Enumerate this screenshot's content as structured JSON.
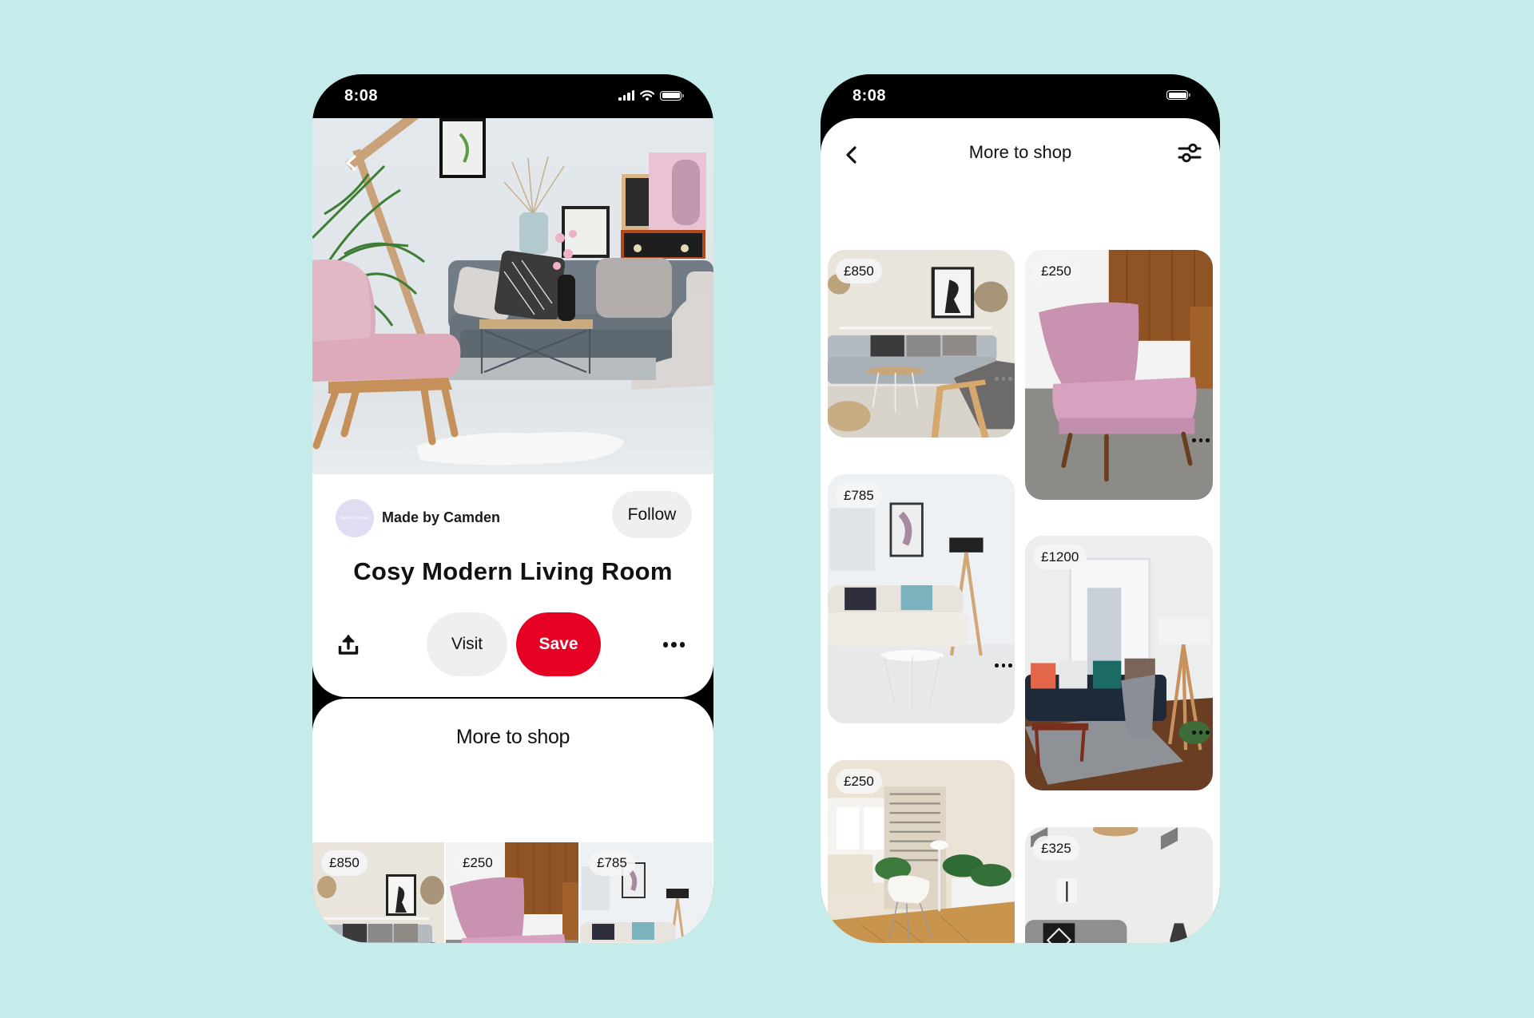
{
  "background_color": "#c5ecea",
  "left_phone": {
    "status_bar": {
      "time": "8:08",
      "icons": [
        "cellular-signal-icon",
        "wifi-icon",
        "battery-icon"
      ]
    },
    "hero_image": {
      "alt": "Pastel living room with pink armchair, grey sofa, palm plant and fluffy rug",
      "overlay_icon": "back-chevron-icon"
    },
    "creator": {
      "avatar_text": "Made by Camden",
      "name": "Made by Camden",
      "follow_label": "Follow"
    },
    "pin_title": "Cosy Modern Living Room",
    "actions": {
      "share_icon": "share-icon",
      "visit_label": "Visit",
      "save_label": "Save",
      "more_icon": "more-horizontal-icon"
    },
    "accent_color": "#e60023",
    "more_to_shop": {
      "title": "More to shop",
      "items": [
        {
          "price": "£850",
          "alt": "Scandi living room with grey sectional and wooden armchair"
        },
        {
          "price": "£250",
          "alt": "Pink cocktail armchair with wooden legs"
        },
        {
          "price": "£785",
          "alt": "Bright living room with cream sofa and tripod lamp"
        }
      ]
    }
  },
  "right_phone": {
    "status_bar": {
      "time": "8:08",
      "icons": [
        "battery-icon"
      ]
    },
    "header": {
      "back_icon": "back-chevron-icon",
      "title": "More to shop",
      "filter_icon": "filter-sliders-icon"
    },
    "grid": [
      {
        "price": "£850",
        "alt": "Scandi living room with grey sectional",
        "column": "left"
      },
      {
        "price": "£250",
        "alt": "Pink cocktail armchair",
        "column": "right"
      },
      {
        "price": "£785",
        "alt": "Bright living room with cream sofa",
        "column": "left"
      },
      {
        "price": "£1200",
        "alt": "Navy sofa by a large window with tripod lamp",
        "column": "right"
      },
      {
        "price": "£250",
        "alt": "Corner with white shell chair, plants and patterned curtain",
        "column": "left"
      },
      {
        "price": "£325",
        "alt": "Grey sofa with geometric cushion and side table",
        "column": "right"
      }
    ]
  }
}
